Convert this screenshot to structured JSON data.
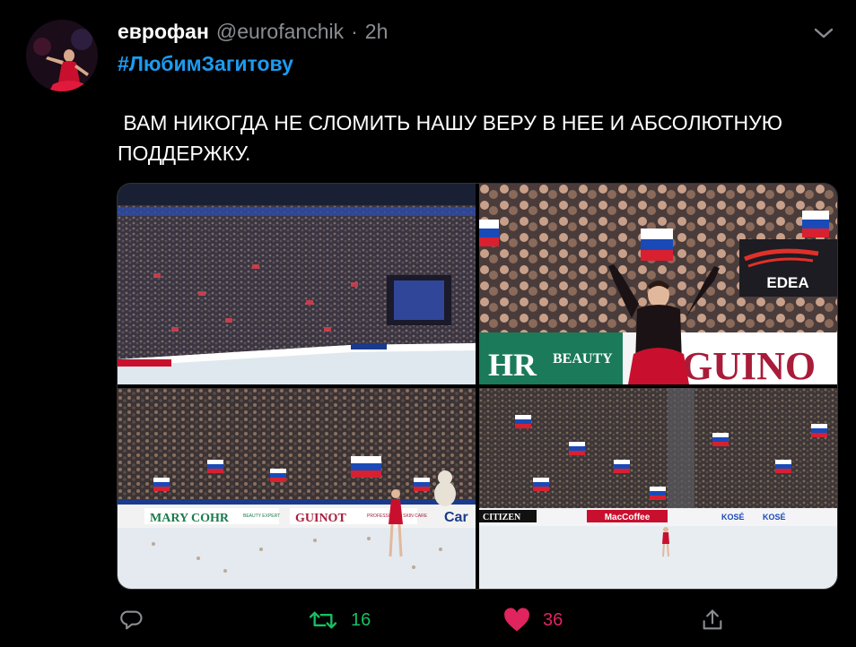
{
  "tweet": {
    "display_name": "еврофан",
    "handle": "@eurofanchik",
    "separator": "·",
    "time": "2h",
    "hashtag": "#ЛюбимЗагитову",
    "text": " ВАМ НИКОГДА НЕ СЛОМИТЬ НАШУ ВЕРУ В НЕЕ И АБСОЛЮТНУЮ ПОДДЕРЖКУ."
  },
  "photos": {
    "p2_brand": "EDEA",
    "p2_banner_left": "HR",
    "p2_banner_mid": "BEAUTY",
    "p2_banner_right": "GUINO",
    "p3_ad1": "MARY COHR",
    "p3_ad1_sub": "BEAUTY EXPERT",
    "p3_ad2": "GUINOT",
    "p3_ad2_sub": "PROFESSIONAL SKIN CARE",
    "p3_ad3": "Car",
    "p4_ad1": "CITIZEN",
    "p4_ad2": "MacCoffee",
    "p4_ad3": "KOSÉ",
    "p4_ad4": "KOSÉ"
  },
  "actions": {
    "retweets": "16",
    "likes": "36"
  },
  "colors": {
    "background": "#000000",
    "link": "#1d9bf0",
    "retweet": "#17bf63",
    "like": "#e0245e",
    "muted": "#8a8d91"
  },
  "icons": [
    "reply-icon",
    "retweet-icon",
    "heart-icon",
    "share-icon",
    "chevron-down-icon"
  ]
}
